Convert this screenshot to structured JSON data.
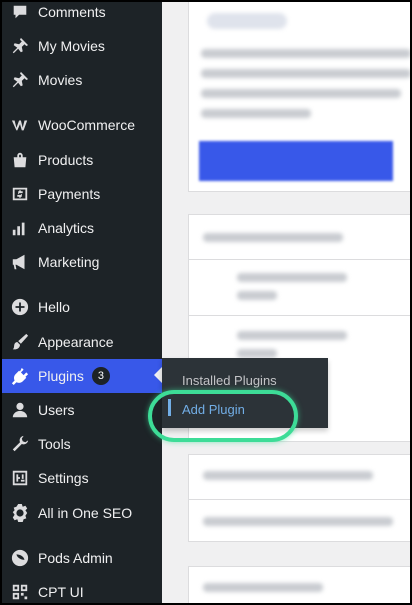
{
  "sidebar": {
    "items": [
      {
        "label": "Comments",
        "icon": "comment-icon"
      },
      {
        "label": "My Movies",
        "icon": "pin-icon"
      },
      {
        "label": "Movies",
        "icon": "pin-icon"
      },
      {
        "label": "WooCommerce",
        "icon": "woocommerce-icon"
      },
      {
        "label": "Products",
        "icon": "products-icon"
      },
      {
        "label": "Payments",
        "icon": "payments-icon"
      },
      {
        "label": "Analytics",
        "icon": "analytics-icon"
      },
      {
        "label": "Marketing",
        "icon": "megaphone-icon"
      },
      {
        "label": "Hello",
        "icon": "plus-circle-icon"
      },
      {
        "label": "Appearance",
        "icon": "brush-icon"
      },
      {
        "label": "Plugins",
        "icon": "plug-icon",
        "badge": "3",
        "active": true
      },
      {
        "label": "Users",
        "icon": "user-icon"
      },
      {
        "label": "Tools",
        "icon": "wrench-icon"
      },
      {
        "label": "Settings",
        "icon": "settings-icon"
      },
      {
        "label": "All in One SEO",
        "icon": "aioseo-icon"
      },
      {
        "label": "Pods Admin",
        "icon": "pods-icon"
      },
      {
        "label": "CPT UI",
        "icon": "cptui-icon"
      }
    ]
  },
  "flyout": {
    "installed_plugins": "Installed Plugins",
    "add_plugin": "Add Plugin"
  },
  "colors": {
    "sidebar_bg": "#1d2327",
    "active_bg": "#3858e9",
    "highlight_ring": "#3ddc97",
    "submenu_current": "#72aee6"
  }
}
